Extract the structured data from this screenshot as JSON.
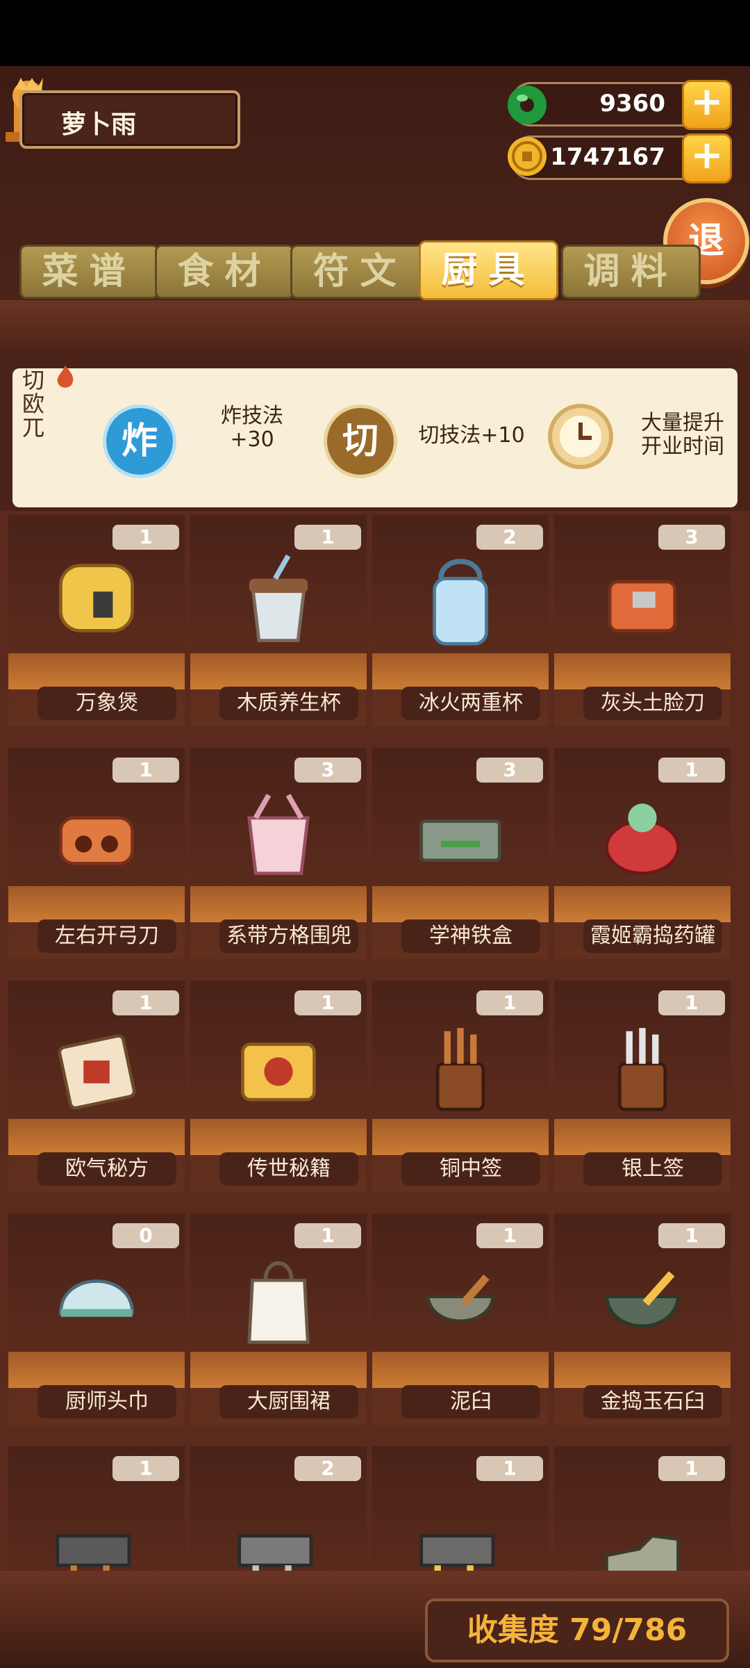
{
  "player": {
    "name": "萝卜雨"
  },
  "currency": {
    "jade": "9360",
    "coins": "1747167"
  },
  "exit_label": "退",
  "tabs": [
    {
      "label": "菜谱"
    },
    {
      "label": "食材"
    },
    {
      "label": "符文"
    },
    {
      "label": "厨具"
    },
    {
      "label": "调料"
    }
  ],
  "active_tab": 3,
  "selected_tool": {
    "name": "切欧兀",
    "skills": [
      {
        "badge": "炸",
        "text": "炸技法\n+30",
        "color": "#2e9bd6"
      },
      {
        "badge": "切",
        "text": "切技法+10",
        "color": "#9a6a2a"
      },
      {
        "badge": "clock-icon",
        "text": "大量提升\n开业时间"
      }
    ]
  },
  "items": [
    {
      "name": "万象煲",
      "count": "1"
    },
    {
      "name": "木质养生杯",
      "count": "1"
    },
    {
      "name": "冰火两重杯",
      "count": "2"
    },
    {
      "name": "灰头土脸刀",
      "count": "3"
    },
    {
      "name": "左右开弓刀",
      "count": "1"
    },
    {
      "name": "系带方格围兜",
      "count": "3"
    },
    {
      "name": "学神铁盒",
      "count": "3"
    },
    {
      "name": "霞姬霸捣药罐",
      "count": "1"
    },
    {
      "name": "欧气秘方",
      "count": "1"
    },
    {
      "name": "传世秘籍",
      "count": "1"
    },
    {
      "name": "铜中签",
      "count": "1"
    },
    {
      "name": "银上签",
      "count": "1"
    },
    {
      "name": "厨师头巾",
      "count": "0"
    },
    {
      "name": "大厨围裙",
      "count": "1"
    },
    {
      "name": "泥臼",
      "count": "1"
    },
    {
      "name": "金捣玉石臼",
      "count": "1"
    },
    {
      "name": "",
      "count": "1"
    },
    {
      "name": "",
      "count": "2"
    },
    {
      "name": "",
      "count": "1"
    },
    {
      "name": "",
      "count": "1"
    }
  ],
  "collection": {
    "text": "收集度 79/786"
  }
}
